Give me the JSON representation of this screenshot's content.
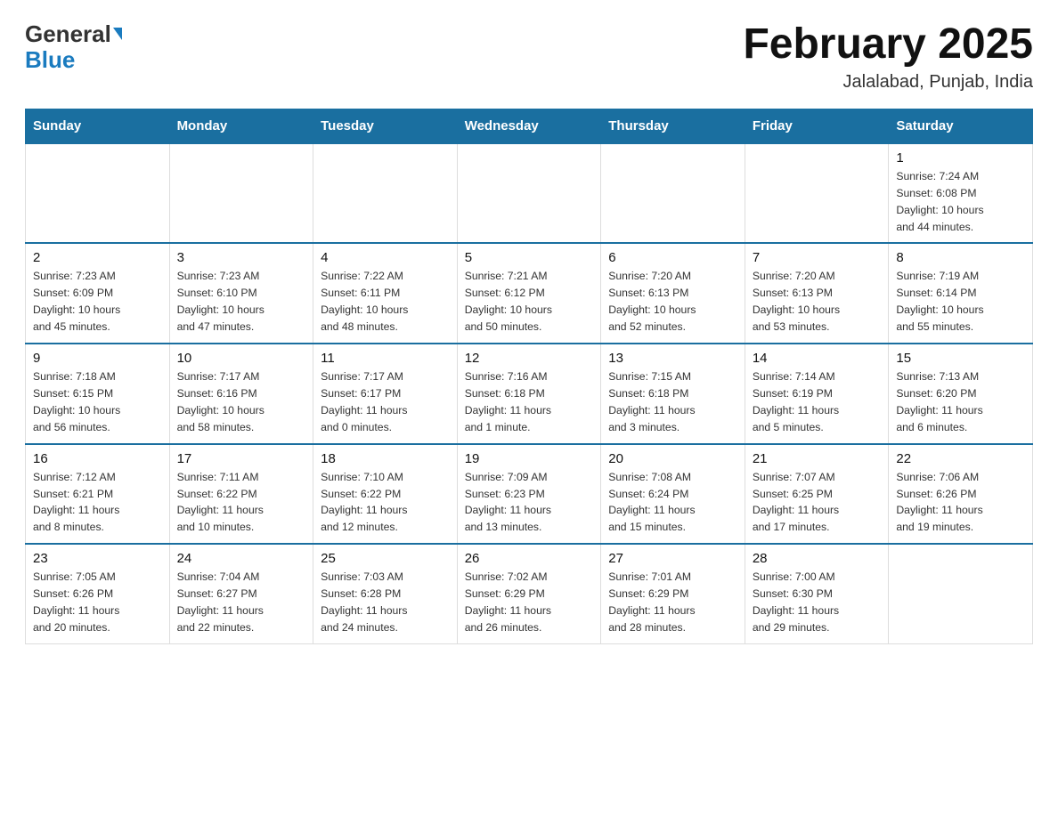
{
  "header": {
    "logo_general": "General",
    "logo_blue": "Blue",
    "month_title": "February 2025",
    "location": "Jalalabad, Punjab, India"
  },
  "weekdays": [
    "Sunday",
    "Monday",
    "Tuesday",
    "Wednesday",
    "Thursday",
    "Friday",
    "Saturday"
  ],
  "weeks": [
    [
      {
        "day": "",
        "info": ""
      },
      {
        "day": "",
        "info": ""
      },
      {
        "day": "",
        "info": ""
      },
      {
        "day": "",
        "info": ""
      },
      {
        "day": "",
        "info": ""
      },
      {
        "day": "",
        "info": ""
      },
      {
        "day": "1",
        "info": "Sunrise: 7:24 AM\nSunset: 6:08 PM\nDaylight: 10 hours\nand 44 minutes."
      }
    ],
    [
      {
        "day": "2",
        "info": "Sunrise: 7:23 AM\nSunset: 6:09 PM\nDaylight: 10 hours\nand 45 minutes."
      },
      {
        "day": "3",
        "info": "Sunrise: 7:23 AM\nSunset: 6:10 PM\nDaylight: 10 hours\nand 47 minutes."
      },
      {
        "day": "4",
        "info": "Sunrise: 7:22 AM\nSunset: 6:11 PM\nDaylight: 10 hours\nand 48 minutes."
      },
      {
        "day": "5",
        "info": "Sunrise: 7:21 AM\nSunset: 6:12 PM\nDaylight: 10 hours\nand 50 minutes."
      },
      {
        "day": "6",
        "info": "Sunrise: 7:20 AM\nSunset: 6:13 PM\nDaylight: 10 hours\nand 52 minutes."
      },
      {
        "day": "7",
        "info": "Sunrise: 7:20 AM\nSunset: 6:13 PM\nDaylight: 10 hours\nand 53 minutes."
      },
      {
        "day": "8",
        "info": "Sunrise: 7:19 AM\nSunset: 6:14 PM\nDaylight: 10 hours\nand 55 minutes."
      }
    ],
    [
      {
        "day": "9",
        "info": "Sunrise: 7:18 AM\nSunset: 6:15 PM\nDaylight: 10 hours\nand 56 minutes."
      },
      {
        "day": "10",
        "info": "Sunrise: 7:17 AM\nSunset: 6:16 PM\nDaylight: 10 hours\nand 58 minutes."
      },
      {
        "day": "11",
        "info": "Sunrise: 7:17 AM\nSunset: 6:17 PM\nDaylight: 11 hours\nand 0 minutes."
      },
      {
        "day": "12",
        "info": "Sunrise: 7:16 AM\nSunset: 6:18 PM\nDaylight: 11 hours\nand 1 minute."
      },
      {
        "day": "13",
        "info": "Sunrise: 7:15 AM\nSunset: 6:18 PM\nDaylight: 11 hours\nand 3 minutes."
      },
      {
        "day": "14",
        "info": "Sunrise: 7:14 AM\nSunset: 6:19 PM\nDaylight: 11 hours\nand 5 minutes."
      },
      {
        "day": "15",
        "info": "Sunrise: 7:13 AM\nSunset: 6:20 PM\nDaylight: 11 hours\nand 6 minutes."
      }
    ],
    [
      {
        "day": "16",
        "info": "Sunrise: 7:12 AM\nSunset: 6:21 PM\nDaylight: 11 hours\nand 8 minutes."
      },
      {
        "day": "17",
        "info": "Sunrise: 7:11 AM\nSunset: 6:22 PM\nDaylight: 11 hours\nand 10 minutes."
      },
      {
        "day": "18",
        "info": "Sunrise: 7:10 AM\nSunset: 6:22 PM\nDaylight: 11 hours\nand 12 minutes."
      },
      {
        "day": "19",
        "info": "Sunrise: 7:09 AM\nSunset: 6:23 PM\nDaylight: 11 hours\nand 13 minutes."
      },
      {
        "day": "20",
        "info": "Sunrise: 7:08 AM\nSunset: 6:24 PM\nDaylight: 11 hours\nand 15 minutes."
      },
      {
        "day": "21",
        "info": "Sunrise: 7:07 AM\nSunset: 6:25 PM\nDaylight: 11 hours\nand 17 minutes."
      },
      {
        "day": "22",
        "info": "Sunrise: 7:06 AM\nSunset: 6:26 PM\nDaylight: 11 hours\nand 19 minutes."
      }
    ],
    [
      {
        "day": "23",
        "info": "Sunrise: 7:05 AM\nSunset: 6:26 PM\nDaylight: 11 hours\nand 20 minutes."
      },
      {
        "day": "24",
        "info": "Sunrise: 7:04 AM\nSunset: 6:27 PM\nDaylight: 11 hours\nand 22 minutes."
      },
      {
        "day": "25",
        "info": "Sunrise: 7:03 AM\nSunset: 6:28 PM\nDaylight: 11 hours\nand 24 minutes."
      },
      {
        "day": "26",
        "info": "Sunrise: 7:02 AM\nSunset: 6:29 PM\nDaylight: 11 hours\nand 26 minutes."
      },
      {
        "day": "27",
        "info": "Sunrise: 7:01 AM\nSunset: 6:29 PM\nDaylight: 11 hours\nand 28 minutes."
      },
      {
        "day": "28",
        "info": "Sunrise: 7:00 AM\nSunset: 6:30 PM\nDaylight: 11 hours\nand 29 minutes."
      },
      {
        "day": "",
        "info": ""
      }
    ]
  ]
}
